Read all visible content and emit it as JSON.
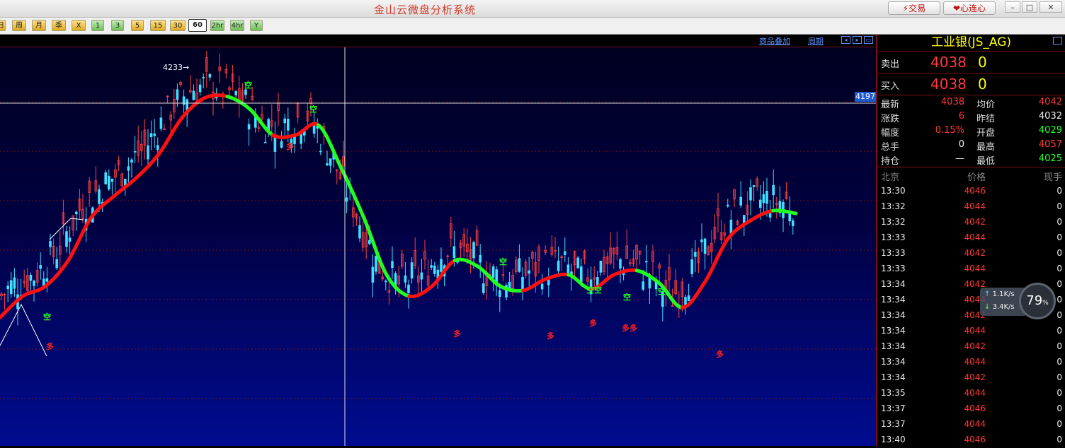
{
  "window": {
    "title": "金山云微盘分析系统",
    "trade_label": "交易",
    "connect_label": "心连心"
  },
  "toolbar": {
    "periods": [
      {
        "label": "日",
        "style": "gold"
      },
      {
        "label": "周",
        "style": "gold"
      },
      {
        "label": "月",
        "style": "gold"
      },
      {
        "label": "季",
        "style": "gold"
      },
      {
        "label": "X",
        "style": "gold"
      },
      {
        "label": "1",
        "style": "green"
      },
      {
        "label": "3",
        "style": "green"
      },
      {
        "label": "5",
        "style": "gold"
      },
      {
        "label": "15",
        "style": "gold"
      },
      {
        "label": "30",
        "style": "gold"
      },
      {
        "label": "60",
        "style": "active"
      },
      {
        "label": "2hr",
        "style": "green"
      },
      {
        "label": "4hr",
        "style": "green"
      },
      {
        "label": "Y",
        "style": "green"
      }
    ]
  },
  "chart_header": {
    "overlay_link": "商品叠加",
    "period_link": "周期"
  },
  "chart": {
    "high_label": "4233→",
    "crosshair_price": "4197",
    "signals": [
      {
        "text": "空",
        "type": "kong"
      },
      {
        "text": "空",
        "type": "kong"
      },
      {
        "text": "空",
        "type": "kong"
      },
      {
        "text": "空空",
        "type": "kong"
      },
      {
        "text": "空",
        "type": "kong"
      },
      {
        "text": "空",
        "type": "kong"
      },
      {
        "text": "空",
        "type": "kong"
      },
      {
        "text": "多",
        "type": "duo"
      },
      {
        "text": "多",
        "type": "duo"
      },
      {
        "text": "多",
        "type": "duo"
      },
      {
        "text": "多",
        "type": "duo"
      },
      {
        "text": "多",
        "type": "duo"
      },
      {
        "text": "多多",
        "type": "duo"
      },
      {
        "text": "多",
        "type": "duo"
      }
    ]
  },
  "chart_data": {
    "type": "line",
    "series": [
      {
        "values": [
          4060,
          4075,
          4082,
          4100,
          4130,
          4145,
          4158,
          4175,
          4200,
          4214,
          4215,
          4206,
          4188,
          4188,
          4195,
          4165,
          4130,
          4090,
          4075,
          4082,
          4100,
          4096,
          4082,
          4079,
          4087,
          4090,
          4080,
          4090,
          4093,
          4084,
          4067,
          4085,
          4115,
          4128,
          4135,
          4133
        ]
      }
    ]
  },
  "quote": {
    "title": "工业银(JS_AG)",
    "ask_label": "卖出",
    "ask_price": "4038",
    "ask_vol": "0",
    "bid_label": "买入",
    "bid_price": "4038",
    "bid_vol": "0",
    "stats": [
      {
        "l1": "最新",
        "v1": "4038",
        "c1": "red",
        "l2": "均价",
        "v2": "4042",
        "c2": "red"
      },
      {
        "l1": "涨跌",
        "v1": "6",
        "c1": "red",
        "l2": "昨结",
        "v2": "4032",
        "c2": "wht"
      },
      {
        "l1": "幅度",
        "v1": "0.15%",
        "c1": "red",
        "l2": "开盘",
        "v2": "4029",
        "c2": "grn"
      },
      {
        "l1": "总手",
        "v1": "0",
        "c1": "wht",
        "l2": "最高",
        "v2": "4057",
        "c2": "red"
      },
      {
        "l1": "持仓",
        "v1": "—",
        "c1": "wht",
        "l2": "最低",
        "v2": "4025",
        "c2": "grn"
      }
    ],
    "tick_header": {
      "time": "北京",
      "price": "价格",
      "vol": "现手"
    },
    "ticks": [
      {
        "time": "13:30",
        "price": "4046",
        "vol": "0"
      },
      {
        "time": "13:32",
        "price": "4044",
        "vol": "0"
      },
      {
        "time": "13:32",
        "price": "4042",
        "vol": "0"
      },
      {
        "time": "13:33",
        "price": "4044",
        "vol": "0"
      },
      {
        "time": "13:33",
        "price": "4042",
        "vol": "0"
      },
      {
        "time": "13:33",
        "price": "4044",
        "vol": "0"
      },
      {
        "time": "13:34",
        "price": "4042",
        "vol": "0"
      },
      {
        "time": "13:34",
        "price": "4044",
        "vol": "0"
      },
      {
        "time": "13:34",
        "price": "4042",
        "vol": "0"
      },
      {
        "time": "13:34",
        "price": "4044",
        "vol": "0"
      },
      {
        "time": "13:34",
        "price": "4042",
        "vol": "0"
      },
      {
        "time": "13:34",
        "price": "4044",
        "vol": "0"
      },
      {
        "time": "13:34",
        "price": "4042",
        "vol": "0"
      },
      {
        "time": "13:35",
        "price": "4044",
        "vol": "0"
      },
      {
        "time": "13:37",
        "price": "4046",
        "vol": "0"
      },
      {
        "time": "13:37",
        "price": "4044",
        "vol": "0"
      },
      {
        "time": "13:40",
        "price": "4046",
        "vol": "0"
      }
    ]
  },
  "net_widget": {
    "up": "1.1",
    "down": "3.4",
    "unit": "K/s",
    "percent": "79",
    "percent_sign": "%"
  }
}
